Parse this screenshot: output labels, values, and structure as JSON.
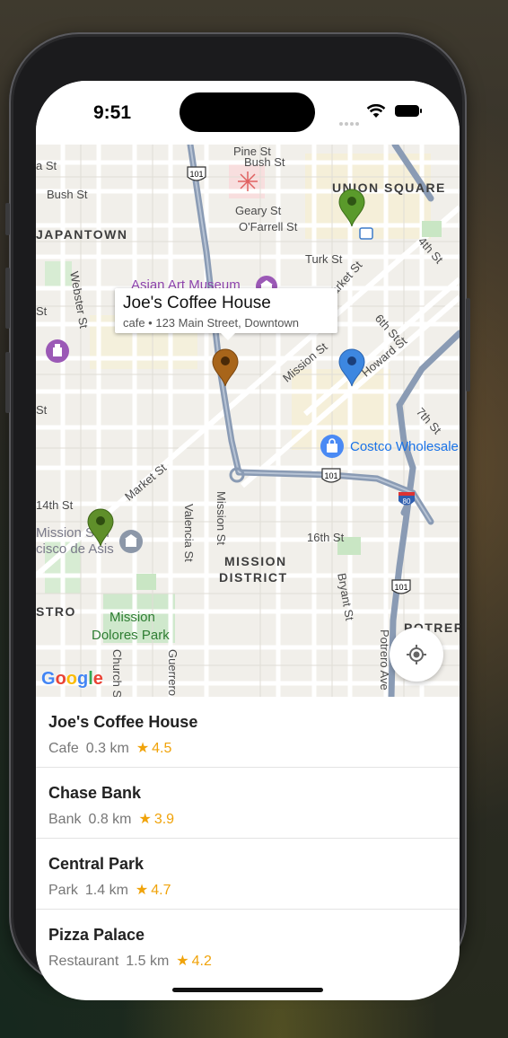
{
  "status_bar": {
    "time": "9:51"
  },
  "map": {
    "labels": {
      "pine_st": "Pine St",
      "bush_st": "Bush St",
      "bush_st_left": "Bush St",
      "st_top_left": "a St",
      "geary_st": "Geary St",
      "ofarrell_st": "O'Farrell St",
      "union_square": "UNION SQUARE",
      "japantown": "JAPANTOWN",
      "turk_st": "Turk St",
      "market_st_top": "Market St",
      "fourth_st": "4th St",
      "asian_art_museum": "Asian Art Museum",
      "webster_st": "Webster St",
      "sixth_st": "6th St",
      "mission_st_diag": "Mission St",
      "howard_st": "Howard St",
      "seventh_st": "7th St",
      "st_left_1": "St",
      "st_left_2": "St",
      "costco": "Costco Wholesale",
      "market_st_low": "Market St",
      "hwy_101_top": "101",
      "hwy_101_mid": "101",
      "hwy_101_low": "101",
      "hwy_80": "80",
      "fourteenth_st": "14th St",
      "mission_san": "Mission San",
      "cisco_de_asis": "cisco de Asis",
      "valencia_st": "Valencia St",
      "mission_st_vert": "Mission St",
      "sixteenth_st": "16th St",
      "mission_district_1": "MISSION",
      "mission_district_2": "DISTRICT",
      "bryant_st": "Bryant St",
      "stro": "STRO",
      "mission_dolores_1": "Mission",
      "mission_dolores_2": "Dolores Park",
      "potrero_ave": "Potrero Ave",
      "potrero_hill": "POTRER",
      "church_st": "Church St",
      "guerrero_st": "Guerrero St"
    },
    "callout": {
      "title": "Joe's Coffee House",
      "subtitle": "cafe • 123 Main Street, Downtown"
    },
    "pins": [
      {
        "name": "Joe's Coffee House",
        "color": "#a8651a"
      },
      {
        "name": "Union Square pin",
        "color": "#5a9a2b"
      },
      {
        "name": "SoMa pin",
        "color": "#3d87e0"
      },
      {
        "name": "Mission pin",
        "color": "#5f8f2a"
      }
    ],
    "google_logo": [
      "G",
      "o",
      "o",
      "g",
      "l",
      "e"
    ],
    "google_colors": [
      "#4285F4",
      "#EA4335",
      "#FBBC05",
      "#4285F4",
      "#34A853",
      "#EA4335"
    ],
    "locate_icon": "my-location-icon"
  },
  "places": [
    {
      "name": "Joe's Coffee House",
      "category": "Cafe",
      "distance": "0.3 km",
      "rating": "4.5"
    },
    {
      "name": "Chase Bank",
      "category": "Bank",
      "distance": "0.8 km",
      "rating": "3.9"
    },
    {
      "name": "Central Park",
      "category": "Park",
      "distance": "1.4 km",
      "rating": "4.7"
    },
    {
      "name": "Pizza Palace",
      "category": "Restaurant",
      "distance": "1.5 km",
      "rating": "4.2"
    }
  ],
  "star_glyph": "★",
  "colors": {
    "rating": "#f0a30a",
    "highway": "#8a9bb4"
  }
}
